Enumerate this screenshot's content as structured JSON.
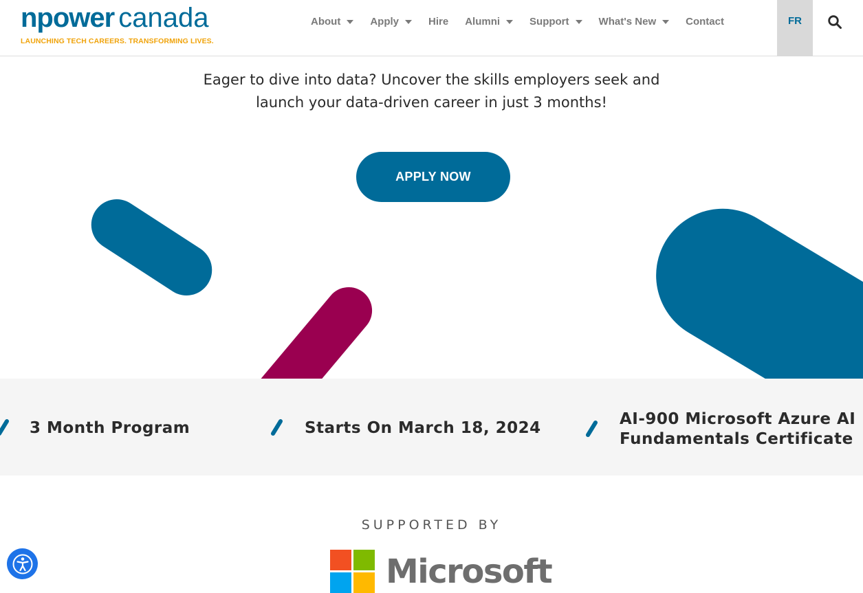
{
  "header": {
    "logo_npower": "npower",
    "logo_canada": "canada",
    "logo_tagline": "LAUNCHING TECH CAREERS.  TRANSFORMING LIVES.",
    "nav": [
      {
        "label": "About",
        "dropdown": true
      },
      {
        "label": "Apply",
        "dropdown": true
      },
      {
        "label": "Hire",
        "dropdown": false
      },
      {
        "label": "Alumni",
        "dropdown": true
      },
      {
        "label": "Support",
        "dropdown": true
      },
      {
        "label": "What's New",
        "dropdown": true
      },
      {
        "label": "Contact",
        "dropdown": false
      }
    ],
    "lang": "FR",
    "search_icon": "search-icon"
  },
  "hero": {
    "line1": "Eager to dive into data? Uncover the skills employers seek and",
    "line2": "launch your data-driven career in just 3 months!",
    "cta": "APPLY NOW"
  },
  "features": [
    {
      "text": "3 Month Program"
    },
    {
      "text": "Starts On March 18, 2024"
    },
    {
      "line1": "AI-900 Microsoft Azure AI",
      "line2": "Fundamentals Certificate"
    }
  ],
  "supported": {
    "heading": "SUPPORTED BY",
    "sponsor": "Microsoft"
  },
  "colors": {
    "brand_blue": "#006b99",
    "brand_magenta": "#9a0050",
    "tagline_orange": "#f0a30a",
    "ms_red": "#f25022",
    "ms_green": "#7fba00",
    "ms_blue": "#00a4ef",
    "ms_yellow": "#ffb900",
    "a11y_blue": "#1e73e8"
  }
}
